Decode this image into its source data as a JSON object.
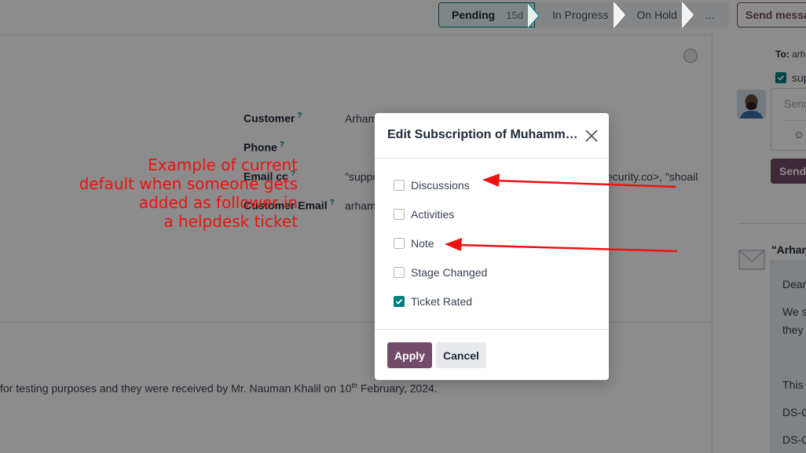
{
  "stages": [
    {
      "label": "Pending",
      "count": "15d",
      "active": true
    },
    {
      "label": "In Progress"
    },
    {
      "label": "On Hold"
    },
    {
      "label": "..."
    }
  ],
  "header": {
    "send_message": "Send message"
  },
  "form": {
    "customer": {
      "label": "Customer",
      "value": "Arham"
    },
    "phone": {
      "label": "Phone"
    },
    "email_cc": {
      "label": "Email cc",
      "value": "\"support",
      "value_tail": "ecurity.co>, \"shoail"
    },
    "customer_email": {
      "label": "Customer Email",
      "value": "arham"
    },
    "tooltip_marker": "?",
    "description": {
      "before": "for testing purposes and they were received by Mr. Nauman Khalil on 10",
      "sup": "th",
      "after": " February, 2024."
    }
  },
  "annotation": {
    "lines": [
      "Example of current",
      "default when someone gets",
      "added as follower in",
      "a helpdesk ticket"
    ]
  },
  "chatter": {
    "to_label": "To:",
    "to_value": "arham",
    "follower": "support",
    "composer_placeholder": "Send",
    "send_button": "Send",
    "author": "\"Arham",
    "message_lines": [
      "Dear",
      "We s",
      "they",
      "This",
      "DS-Q",
      "DS-Q"
    ]
  },
  "modal": {
    "title": "Edit Subscription of Muhammad Arham",
    "options": [
      {
        "label": "Discussions",
        "checked": false
      },
      {
        "label": "Activities",
        "checked": false
      },
      {
        "label": "Note",
        "checked": false
      },
      {
        "label": "Stage Changed",
        "checked": false
      },
      {
        "label": "Ticket Rated",
        "checked": true
      }
    ],
    "apply": "Apply",
    "cancel": "Cancel"
  },
  "colors": {
    "primary": "#714b67",
    "accent": "#017e84",
    "annotation": "#ee1111"
  }
}
